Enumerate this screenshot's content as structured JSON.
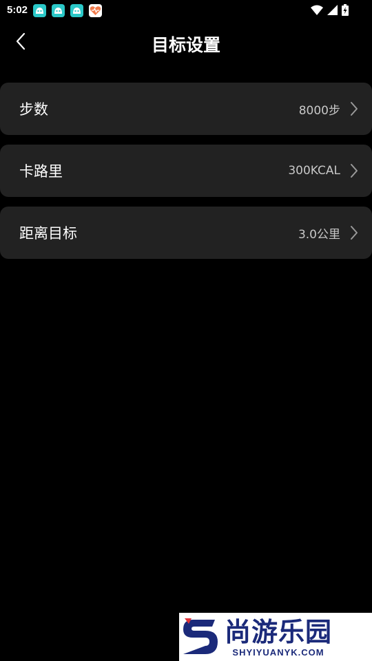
{
  "status_bar": {
    "time": "5:02",
    "notification_icons": [
      "app-notification-icon",
      "app-notification-icon",
      "app-notification-icon",
      "health-app-icon"
    ],
    "system_icons": [
      "wifi-icon",
      "signal-icon",
      "battery-charging-icon"
    ]
  },
  "header": {
    "title": "目标设置",
    "back_icon": "chevron-left-icon"
  },
  "settings": [
    {
      "label": "步数",
      "value": "8000步"
    },
    {
      "label": "卡路里",
      "value": "300KCAL"
    },
    {
      "label": "距离目标",
      "value": "3.0公里"
    }
  ],
  "watermark": {
    "title": "尚游乐园",
    "url": "SHYIYUANYK.COM"
  },
  "colors": {
    "background": "#000000",
    "row_background": "#222222",
    "value_text": "#c8c8c8",
    "watermark_brand": "#1b2a7a"
  }
}
